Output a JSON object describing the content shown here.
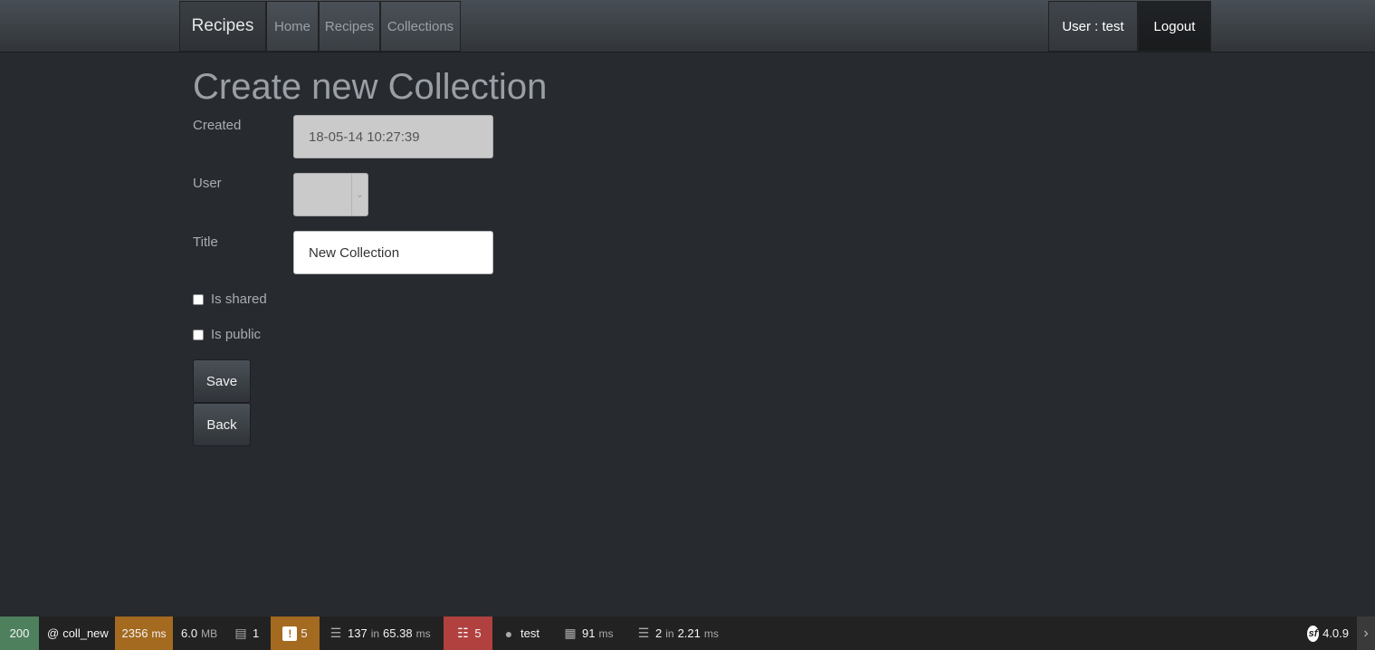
{
  "navbar": {
    "brand": "Recipes",
    "links": [
      "Home",
      "Recipes",
      "Collections"
    ],
    "user": "User : test",
    "logout": "Logout"
  },
  "form": {
    "title": "Create new Collection",
    "created_label": "Created",
    "created_value": "18-05-14 10:27:39",
    "user_label": "User",
    "user_value": "",
    "title_label": "Title",
    "title_value": "New Collection",
    "shared_label": "Is shared",
    "shared_checked": false,
    "public_label": "Is public",
    "public_checked": false,
    "save_label": "Save",
    "back_label": "Back"
  },
  "toolbar": {
    "status": "200",
    "route_prefix": "@",
    "route": "coll_new",
    "time": "2356",
    "time_unit": "ms",
    "memory": "6.0",
    "memory_unit": "MB",
    "logs": "1",
    "warnings": "5",
    "queries": "137",
    "queries_in": "in",
    "queries_time": "65.38",
    "queries_unit": "ms",
    "translations": "5",
    "user": "test",
    "twig_time": "91",
    "twig_unit": "ms",
    "cache_calls": "2",
    "cache_in": "in",
    "cache_time": "2.21",
    "cache_unit": "ms",
    "version": "4.0.9",
    "colors": {
      "status": "#4f805d",
      "warning": "#a46a1f",
      "error": "#b0413e"
    }
  }
}
